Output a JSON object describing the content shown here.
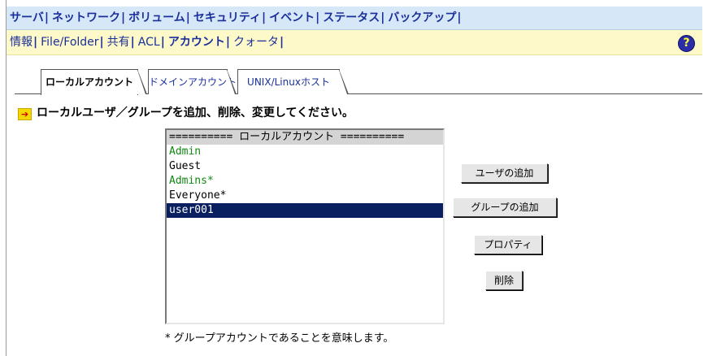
{
  "main_nav": {
    "items": [
      "サーバ",
      "ネットワーク",
      "ボリューム",
      "セキュリティ",
      "イベント",
      "ステータス",
      "バックアップ"
    ],
    "active": "セキュリティ"
  },
  "sub_nav": {
    "items": [
      "情報",
      "File/Folder",
      "共有",
      "ACL",
      "アカウント",
      "クォータ"
    ],
    "active": "アカウント",
    "help_icon": "?"
  },
  "tabs": [
    {
      "label": "ローカルアカウント",
      "active": true
    },
    {
      "label": "ドメインアカウント",
      "active": false
    },
    {
      "label": "UNIX/Linuxホスト",
      "active": false
    }
  ],
  "instruction": {
    "icon": "arrow-right-icon",
    "text": "ローカルユーザ／グループを追加、削除、変更してください。"
  },
  "account_list": {
    "header": "========== ローカルアカウント ==========",
    "items": [
      {
        "name": "Admin",
        "color": "#118811",
        "selected": false
      },
      {
        "name": "Guest",
        "color": "#000000",
        "selected": false
      },
      {
        "name": "Admins*",
        "color": "#118811",
        "selected": false
      },
      {
        "name": "Everyone*",
        "color": "#000000",
        "selected": false
      },
      {
        "name": "user001",
        "color": "#ffffff",
        "selected": true
      }
    ]
  },
  "buttons": {
    "add_user": "ユーザの追加",
    "add_group": "グループの追加",
    "properties": "プロパティ",
    "delete": "削除"
  },
  "footnote": "* グループアカウントであることを意味します。"
}
